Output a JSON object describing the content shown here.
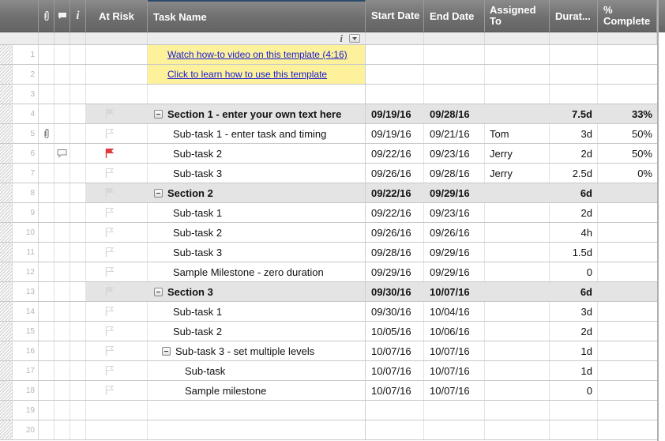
{
  "header": {
    "attachments_icon": "paperclip-icon",
    "comments_icon": "comment-icon",
    "info_icon": "info-icon",
    "at_risk": "At Risk",
    "task_name": "Task Name",
    "start_date": "Start Date",
    "end_date": "End Date",
    "assigned_to": "Assigned To",
    "duration": "Durat...",
    "percent_complete": "% Complete"
  },
  "filter_row": {
    "info_glyph": "i",
    "dropdown_icon": "chevron-down-icon"
  },
  "colors": {
    "header_bg": "#6f6f6f",
    "section_bg": "#e4e4e4",
    "link_bg": "#fdf29b",
    "link_color": "#1a1ad6",
    "flag_red": "#e03c3c",
    "flag_empty": "#d8d8d8"
  },
  "rows": [
    {
      "num": "1",
      "type": "link",
      "task": "Watch how-to video on this template (4:16)",
      "start": "",
      "end": "",
      "assigned": "",
      "duration": "",
      "complete": "",
      "attachment": false,
      "comment": false,
      "flag": ""
    },
    {
      "num": "2",
      "type": "link",
      "task": "Click to learn how to use this template",
      "start": "",
      "end": "",
      "assigned": "",
      "duration": "",
      "complete": "",
      "attachment": false,
      "comment": false,
      "flag": ""
    },
    {
      "num": "3",
      "type": "empty",
      "task": "",
      "start": "",
      "end": "",
      "assigned": "",
      "duration": "",
      "complete": "",
      "attachment": false,
      "comment": false,
      "flag": ""
    },
    {
      "num": "4",
      "type": "section",
      "task": "Section 1 - enter your own text here",
      "start": "09/19/16",
      "end": "09/28/16",
      "assigned": "",
      "duration": "7.5d",
      "complete": "33%",
      "attachment": false,
      "comment": false,
      "flag": "empty"
    },
    {
      "num": "5",
      "type": "task",
      "task": "Sub-task 1 - enter task and timing",
      "start": "09/19/16",
      "end": "09/21/16",
      "assigned": "Tom",
      "duration": "3d",
      "complete": "50%",
      "attachment": true,
      "comment": false,
      "flag": "empty"
    },
    {
      "num": "6",
      "type": "task",
      "task": "Sub-task 2",
      "start": "09/22/16",
      "end": "09/23/16",
      "assigned": "Jerry",
      "duration": "2d",
      "complete": "50%",
      "attachment": false,
      "comment": true,
      "flag": "red"
    },
    {
      "num": "7",
      "type": "task",
      "task": "Sub-task 3",
      "start": "09/26/16",
      "end": "09/28/16",
      "assigned": "Jerry",
      "duration": "2.5d",
      "complete": "0%",
      "attachment": false,
      "comment": false,
      "flag": "empty"
    },
    {
      "num": "8",
      "type": "section",
      "task": "Section 2",
      "start": "09/22/16",
      "end": "09/29/16",
      "assigned": "",
      "duration": "6d",
      "complete": "",
      "attachment": false,
      "comment": false,
      "flag": "empty"
    },
    {
      "num": "9",
      "type": "task",
      "task": "Sub-task 1",
      "start": "09/22/16",
      "end": "09/23/16",
      "assigned": "",
      "duration": "2d",
      "complete": "",
      "attachment": false,
      "comment": false,
      "flag": "empty"
    },
    {
      "num": "10",
      "type": "task",
      "task": "Sub-task 2",
      "start": "09/26/16",
      "end": "09/26/16",
      "assigned": "",
      "duration": "4h",
      "complete": "",
      "attachment": false,
      "comment": false,
      "flag": "empty"
    },
    {
      "num": "11",
      "type": "task",
      "task": "Sub-task 3",
      "start": "09/28/16",
      "end": "09/29/16",
      "assigned": "",
      "duration": "1.5d",
      "complete": "",
      "attachment": false,
      "comment": false,
      "flag": "empty"
    },
    {
      "num": "12",
      "type": "task",
      "task": "Sample Milestone - zero duration",
      "start": "09/29/16",
      "end": "09/29/16",
      "assigned": "",
      "duration": "0",
      "complete": "",
      "attachment": false,
      "comment": false,
      "flag": "empty"
    },
    {
      "num": "13",
      "type": "section",
      "task": "Section 3",
      "start": "09/30/16",
      "end": "10/07/16",
      "assigned": "",
      "duration": "6d",
      "complete": "",
      "attachment": false,
      "comment": false,
      "flag": "empty"
    },
    {
      "num": "14",
      "type": "task",
      "task": "Sub-task 1",
      "start": "09/30/16",
      "end": "10/04/16",
      "assigned": "",
      "duration": "3d",
      "complete": "",
      "attachment": false,
      "comment": false,
      "flag": "empty"
    },
    {
      "num": "15",
      "type": "task",
      "task": "Sub-task 2",
      "start": "10/05/16",
      "end": "10/06/16",
      "assigned": "",
      "duration": "2d",
      "complete": "",
      "attachment": false,
      "comment": false,
      "flag": "empty"
    },
    {
      "num": "16",
      "type": "subparent",
      "task": "Sub-task 3 - set multiple levels",
      "start": "10/07/16",
      "end": "10/07/16",
      "assigned": "",
      "duration": "1d",
      "complete": "",
      "attachment": false,
      "comment": false,
      "flag": "empty"
    },
    {
      "num": "17",
      "type": "subtask",
      "task": "Sub-task",
      "start": "10/07/16",
      "end": "10/07/16",
      "assigned": "",
      "duration": "1d",
      "complete": "",
      "attachment": false,
      "comment": false,
      "flag": "empty"
    },
    {
      "num": "18",
      "type": "subtask",
      "task": "Sample milestone",
      "start": "10/07/16",
      "end": "10/07/16",
      "assigned": "",
      "duration": "0",
      "complete": "",
      "attachment": false,
      "comment": false,
      "flag": "empty"
    },
    {
      "num": "19",
      "type": "empty",
      "task": "",
      "start": "",
      "end": "",
      "assigned": "",
      "duration": "",
      "complete": "",
      "attachment": false,
      "comment": false,
      "flag": ""
    },
    {
      "num": "20",
      "type": "empty",
      "task": "",
      "start": "",
      "end": "",
      "assigned": "",
      "duration": "",
      "complete": "",
      "attachment": false,
      "comment": false,
      "flag": ""
    }
  ]
}
